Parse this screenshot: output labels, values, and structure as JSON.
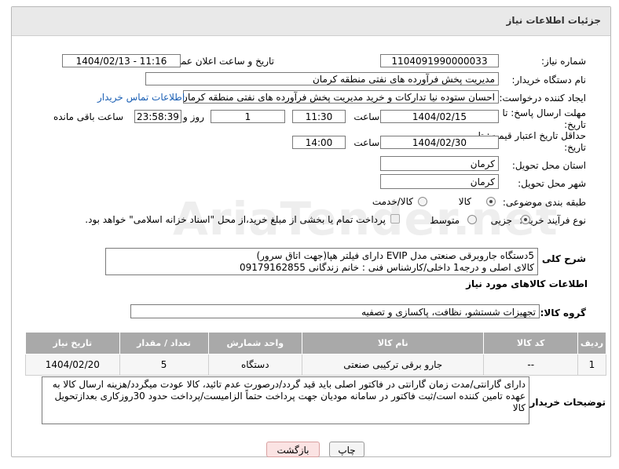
{
  "panel": {
    "title": "جزئیات اطلاعات نیاز"
  },
  "form": {
    "need_number_label": "شماره نیاز:",
    "need_number": "1104091990000033",
    "announce_label": "تاریخ و ساعت اعلان عمومی:",
    "announce_value": "1404/02/13 - 11:16",
    "buyer_org_label": "نام دستگاه خریدار:",
    "buyer_org": "مدیریت پخش فرآورده های نفتی منطقه کرمان",
    "requester_label": "ایجاد کننده درخواست:",
    "requester": "احسان  ستوده نیا  تدارکات و خرید  مدیریت پخش فرآورده های نفتی منطقه کرمان",
    "contact_link": "اطلاعات تماس خریدار",
    "deadline_label": "مهلت ارسال پاسخ: تا تاریخ:",
    "deadline_date": "1404/02/15",
    "time_label": "ساعت",
    "deadline_time": "11:30",
    "days_value": "1",
    "days_label": "روز و",
    "remaining_value": "23:58:39",
    "remaining_label": "ساعت باقی مانده",
    "min_price_label": "حداقل تاریخ اعتبار قیمت: تا تاریخ:",
    "min_price_date": "1404/02/30",
    "min_price_time": "14:00",
    "province_label": "استان محل تحویل:",
    "province": "کرمان",
    "city_label": "شهر محل تحویل:",
    "city": "کرمان",
    "category_label": "طبقه بندی موضوعی:",
    "category_goods": "کالا",
    "category_goods_service": "کالا/خدمت",
    "process_label": "نوع فرآیند خرید :",
    "process_partial": "جزیی",
    "process_medium": "متوسط",
    "payment_note": "پرداخت تمام یا بخشی از مبلغ خرید،از محل \"اسناد خزانه اسلامی\" خواهد بود."
  },
  "description": {
    "label": "شرح کلی نیاز:",
    "line1": "5دستگاه جاروبرقی صنعتی مدل EVIP دارای فیلتر هپا(جهت اتاق سرور)",
    "line2": "کالای اصلی و درجه1 داخلی/کارشناس فنی : خانم زندگانی 09179162855"
  },
  "goods_info": {
    "title": "اطلاعات کالاهای مورد نیاز"
  },
  "goods_group": {
    "label": "گروه کالا:",
    "value": "تجهیزات شستشو، نظافت، پاکسازی و تصفیه"
  },
  "table": {
    "headers": [
      "ردیف",
      "کد کالا",
      "نام کالا",
      "واحد شمارش",
      "تعداد / مقدار",
      "تاریخ نیاز"
    ],
    "rows": [
      {
        "row": "1",
        "code": "--",
        "name": "جارو برقی ترکیبی صنعتی",
        "unit": "دستگاه",
        "qty": "5",
        "date": "1404/02/20"
      }
    ]
  },
  "buyer_notes": {
    "label": "توضیحات خریدار:",
    "line1": "دارای گارانتی/مدت زمان گارانتی در فاکتور اصلی باید قید گردد/درصورت عدم تائید، کالا عودت میگردد/هزینه ارسال کالا به",
    "line2": "عهده تامین کننده است/ثبت فاکتور در سامانه مودیان جهت پرداخت حتماً الزامیست/پرداخت حدود 30روزکاری بعدازتحویل کالا"
  },
  "buttons": {
    "print": "چاپ",
    "back": "بازگشت"
  },
  "watermark": "AriaTender.net"
}
